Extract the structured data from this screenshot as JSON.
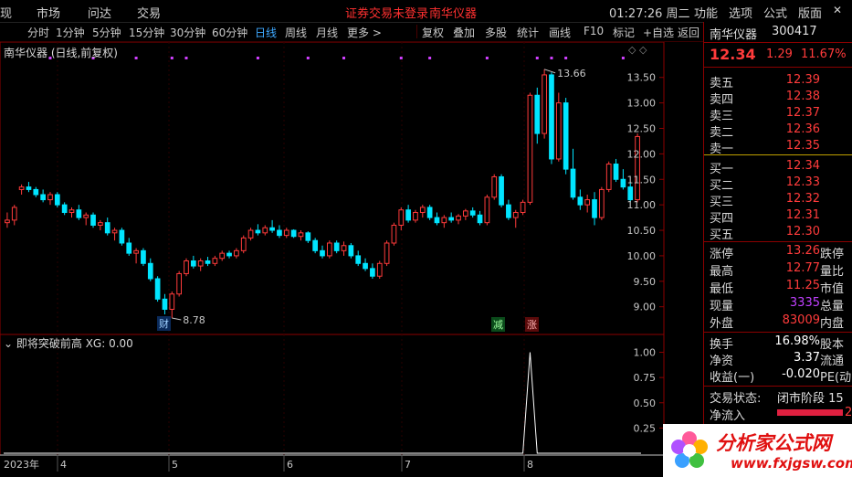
{
  "menu": {
    "items": [
      "现",
      "分时",
      "市场",
      "问达",
      "交易"
    ],
    "login_status": "证券交易未登录",
    "stock_name_top": "南华仪器",
    "clock": "01:27:26 周二",
    "right_items": [
      "功能",
      "选项",
      "公式",
      "版面"
    ]
  },
  "periods": {
    "items": [
      "分时",
      "1分钟",
      "5分钟",
      "15分钟",
      "30分钟",
      "60分钟",
      "日线",
      "周线",
      "月线",
      "更多 >"
    ],
    "active": "日线",
    "tools": [
      "复权",
      "叠加",
      "多股",
      "统计",
      "画线",
      "F10",
      "标记",
      "+自选",
      "返回"
    ]
  },
  "chart": {
    "title": "南华仪器 (日线,前复权)",
    "high_marker": "13.66",
    "low_marker": "8.78",
    "badges": {
      "cai": "财",
      "jian": "减",
      "zhang": "涨"
    },
    "indicator_label": "即将突破前高  XG: 0.00",
    "x_labels": [
      "2023年",
      "4",
      "5",
      "6",
      "7",
      "8"
    ]
  },
  "chart_data": [
    {
      "type": "candlestick",
      "title": "南华仪器 (日线,前复权)",
      "ylim": [
        8.6,
        13.8
      ],
      "y_ticks": [
        9.0,
        9.5,
        10.0,
        10.5,
        11.0,
        11.5,
        12.0,
        12.5,
        13.0,
        13.5
      ],
      "x_labels": [
        "2023年",
        "4",
        "5",
        "6",
        "7",
        "8"
      ],
      "annotations": [
        {
          "text": "13.66",
          "kind": "high"
        },
        {
          "text": "8.78",
          "kind": "low"
        }
      ],
      "ohlc": [
        [
          10.65,
          10.85,
          10.55,
          10.7
        ],
        [
          10.7,
          11.0,
          10.6,
          10.95
        ],
        [
          11.3,
          11.4,
          11.2,
          11.35
        ],
        [
          11.35,
          11.45,
          11.25,
          11.3
        ],
        [
          11.3,
          11.35,
          11.15,
          11.2
        ],
        [
          11.2,
          11.3,
          11.05,
          11.1
        ],
        [
          11.1,
          11.25,
          11.0,
          11.2
        ],
        [
          11.2,
          11.25,
          10.95,
          11.0
        ],
        [
          11.0,
          11.05,
          10.8,
          10.85
        ],
        [
          10.85,
          10.95,
          10.75,
          10.9
        ],
        [
          10.9,
          11.0,
          10.7,
          10.75
        ],
        [
          10.75,
          10.85,
          10.6,
          10.8
        ],
        [
          10.8,
          10.85,
          10.55,
          10.6
        ],
        [
          10.6,
          10.7,
          10.5,
          10.65
        ],
        [
          10.65,
          10.75,
          10.4,
          10.45
        ],
        [
          10.45,
          10.55,
          10.3,
          10.5
        ],
        [
          10.5,
          10.55,
          10.2,
          10.25
        ],
        [
          10.25,
          10.35,
          10.0,
          10.05
        ],
        [
          10.05,
          10.15,
          9.85,
          10.1
        ],
        [
          10.1,
          10.15,
          9.8,
          9.85
        ],
        [
          9.85,
          9.95,
          9.5,
          9.55
        ],
        [
          9.55,
          9.6,
          9.1,
          9.15
        ],
        [
          9.15,
          9.25,
          8.85,
          8.95
        ],
        [
          8.95,
          9.3,
          8.78,
          9.25
        ],
        [
          9.25,
          9.7,
          9.2,
          9.65
        ],
        [
          9.65,
          9.95,
          9.6,
          9.9
        ],
        [
          9.9,
          10.0,
          9.75,
          9.8
        ],
        [
          9.8,
          9.95,
          9.7,
          9.9
        ],
        [
          9.9,
          9.98,
          9.8,
          9.85
        ],
        [
          9.85,
          10.0,
          9.8,
          9.95
        ],
        [
          9.95,
          10.1,
          9.9,
          10.05
        ],
        [
          10.05,
          10.1,
          9.95,
          10.0
        ],
        [
          10.0,
          10.15,
          9.95,
          10.1
        ],
        [
          10.1,
          10.4,
          10.05,
          10.35
        ],
        [
          10.35,
          10.55,
          10.3,
          10.5
        ],
        [
          10.5,
          10.62,
          10.4,
          10.45
        ],
        [
          10.45,
          10.6,
          10.4,
          10.55
        ],
        [
          10.55,
          10.7,
          10.45,
          10.5
        ],
        [
          10.5,
          10.6,
          10.35,
          10.4
        ],
        [
          10.4,
          10.55,
          10.35,
          10.5
        ],
        [
          10.5,
          10.52,
          10.35,
          10.38
        ],
        [
          10.38,
          10.5,
          10.3,
          10.45
        ],
        [
          10.45,
          10.48,
          10.25,
          10.3
        ],
        [
          10.3,
          10.35,
          10.05,
          10.1
        ],
        [
          10.1,
          10.2,
          9.95,
          10.0
        ],
        [
          10.0,
          10.3,
          9.95,
          10.25
        ],
        [
          10.25,
          10.3,
          10.05,
          10.1
        ],
        [
          10.1,
          10.28,
          10.0,
          10.2
        ],
        [
          10.2,
          10.25,
          9.95,
          10.0
        ],
        [
          10.0,
          10.1,
          9.8,
          9.85
        ],
        [
          9.85,
          9.95,
          9.7,
          9.75
        ],
        [
          9.75,
          9.85,
          9.55,
          9.6
        ],
        [
          9.6,
          9.9,
          9.55,
          9.85
        ],
        [
          9.85,
          10.3,
          9.8,
          10.25
        ],
        [
          10.25,
          10.65,
          10.2,
          10.6
        ],
        [
          10.6,
          10.95,
          10.5,
          10.9
        ],
        [
          10.9,
          11.0,
          10.65,
          10.7
        ],
        [
          10.7,
          10.9,
          10.65,
          10.85
        ],
        [
          10.85,
          11.0,
          10.75,
          10.95
        ],
        [
          10.95,
          11.0,
          10.7,
          10.75
        ],
        [
          10.75,
          10.85,
          10.6,
          10.65
        ],
        [
          10.65,
          10.8,
          10.55,
          10.75
        ],
        [
          10.75,
          10.85,
          10.65,
          10.7
        ],
        [
          10.7,
          10.82,
          10.62,
          10.78
        ],
        [
          10.78,
          10.92,
          10.7,
          10.88
        ],
        [
          10.88,
          10.95,
          10.75,
          10.8
        ],
        [
          10.8,
          10.88,
          10.6,
          10.65
        ],
        [
          10.65,
          11.2,
          10.6,
          11.15
        ],
        [
          11.15,
          11.6,
          11.1,
          11.55
        ],
        [
          11.55,
          11.6,
          10.95,
          11.0
        ],
        [
          11.0,
          11.1,
          10.7,
          10.75
        ],
        [
          10.75,
          10.9,
          10.55,
          10.85
        ],
        [
          10.85,
          11.1,
          10.8,
          11.05
        ],
        [
          11.05,
          13.2,
          11.0,
          13.15
        ],
        [
          13.15,
          13.3,
          12.2,
          12.4
        ],
        [
          12.4,
          13.66,
          12.3,
          13.55
        ],
        [
          13.55,
          13.6,
          11.8,
          11.9
        ],
        [
          11.9,
          13.2,
          11.85,
          13.0
        ],
        [
          13.0,
          13.1,
          11.6,
          11.7
        ],
        [
          11.7,
          12.1,
          11.1,
          11.15
        ],
        [
          11.15,
          11.3,
          10.9,
          11.0
        ],
        [
          11.0,
          11.2,
          10.85,
          11.1
        ],
        [
          11.1,
          11.25,
          10.6,
          10.75
        ],
        [
          10.75,
          11.35,
          10.7,
          11.3
        ],
        [
          11.3,
          11.85,
          11.25,
          11.8
        ],
        [
          11.8,
          11.9,
          11.45,
          11.5
        ],
        [
          11.5,
          11.7,
          11.3,
          11.35
        ],
        [
          11.35,
          11.45,
          11.05,
          11.1
        ],
        [
          11.1,
          12.4,
          11.05,
          12.34
        ]
      ]
    },
    {
      "type": "line",
      "title": "即将突破前高  XG: 0.00",
      "ylim": [
        0,
        1.05
      ],
      "y_ticks": [
        0.25,
        0.5,
        0.75,
        1.0
      ],
      "spike_index": 73,
      "spike_value": 1.0
    }
  ],
  "right_panel": {
    "name": "南华仪器",
    "code": "300417",
    "price": "12.34",
    "change": "1.29",
    "change_pct": "11.67%",
    "asks": [
      {
        "label": "卖五",
        "price": "12.39"
      },
      {
        "label": "卖四",
        "price": "12.38"
      },
      {
        "label": "卖三",
        "price": "12.37"
      },
      {
        "label": "卖二",
        "price": "12.36"
      },
      {
        "label": "卖一",
        "price": "12.35"
      }
    ],
    "bids": [
      {
        "label": "买一",
        "price": "12.34"
      },
      {
        "label": "买二",
        "price": "12.33"
      },
      {
        "label": "买三",
        "price": "12.32"
      },
      {
        "label": "买四",
        "price": "12.31"
      },
      {
        "label": "买五",
        "price": "12.30"
      }
    ],
    "stats": [
      {
        "label": "涨停",
        "value": "13.26",
        "label2": "跌停",
        "color": "#ff3b3b"
      },
      {
        "label": "最高",
        "value": "12.77",
        "label2": "量比",
        "color": "#ff3b3b"
      },
      {
        "label": "最低",
        "value": "11.25",
        "label2": "市值",
        "color": "#ff3b3b"
      },
      {
        "label": "现量",
        "value": "3335",
        "label2": "总量",
        "color": "#c040ff"
      },
      {
        "label": "外盘",
        "value": "83009",
        "label2": "内盘",
        "color": "#ff3b3b"
      }
    ],
    "stats2": [
      {
        "label": "换手",
        "value": "16.98%",
        "label2": "股本",
        "color": "#ffffff"
      },
      {
        "label": "净资",
        "value": "3.37",
        "label2": "流通",
        "color": "#ffffff"
      },
      {
        "label": "收益(一)",
        "value": "-0.020",
        "label2": "PE(动",
        "color": "#ffffff"
      }
    ],
    "trade_status_label": "交易状态:",
    "trade_status_value": "闭市阶段 15",
    "net_inflow_label": "净流入",
    "net_inflow_value": "2"
  },
  "logo": {
    "title": "分析家公式网",
    "url": "www.fxjgsw.com"
  },
  "colors": {
    "up": "#ff3b3b",
    "down": "#00e5ff",
    "accent": "#3fa9ff",
    "frame": "#8b0000"
  }
}
